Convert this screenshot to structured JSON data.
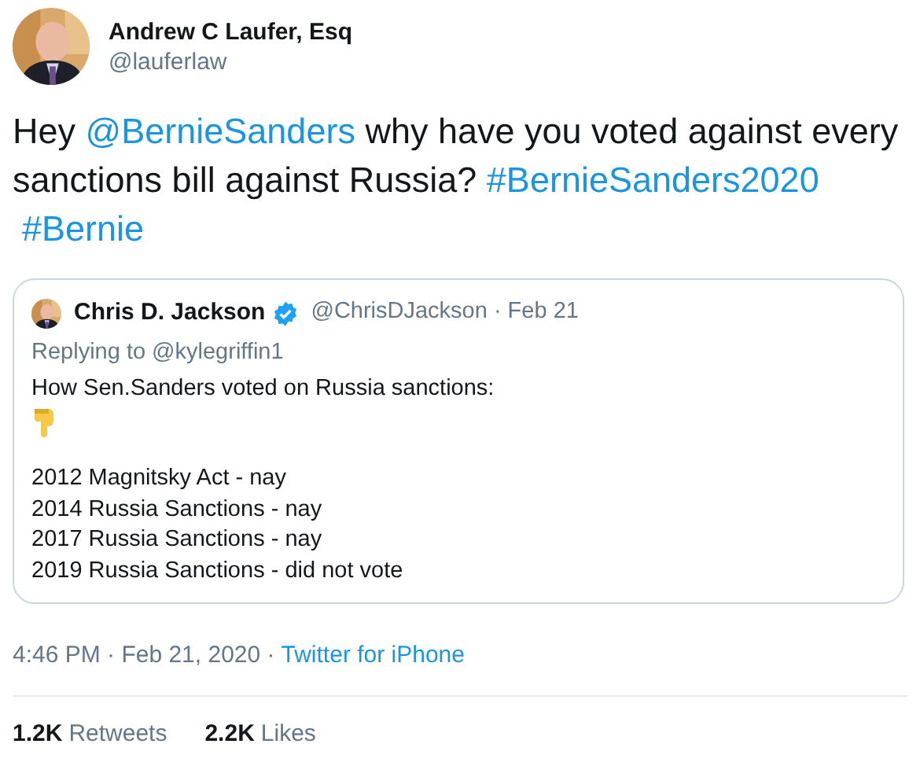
{
  "author": {
    "name": "Andrew C Laufer, Esq",
    "handle": "@lauferlaw"
  },
  "tweet": [
    {
      "kind": "text",
      "text": "Hey "
    },
    {
      "kind": "link",
      "text": "@BernieSanders"
    },
    {
      "kind": "text",
      "text": " why have you voted against every sanctions bill against Russia?  "
    },
    {
      "kind": "link",
      "text": "#BernieSanders2020"
    },
    {
      "kind": "link",
      "text": "#Bernie"
    }
  ],
  "quote": {
    "name": "Chris D. Jackson",
    "verified": true,
    "handle": "@ChrisDJackson",
    "date": "· Feb 21",
    "replying_label": "Replying to",
    "replying_to": "@kylegriffin1",
    "intro": "How Sen.Sanders voted on Russia sanctions:",
    "lines": [
      "2012 Magnitsky Act - nay",
      "2014 Russia Sanctions - nay",
      "2017 Russia Sanctions - nay",
      "2019 Russia Sanctions - did not vote"
    ]
  },
  "meta": {
    "time": "4:46 PM · Feb 21, 2020 ·",
    "source": "Twitter for iPhone"
  },
  "stats": [
    {
      "count": "1.2K",
      "label": "Retweets"
    },
    {
      "count": "2.2K",
      "label": "Likes"
    }
  ]
}
